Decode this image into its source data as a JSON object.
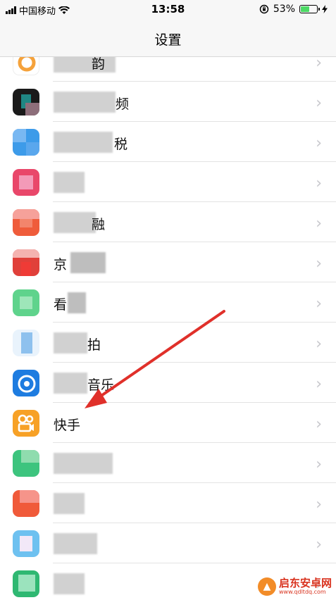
{
  "status_bar": {
    "carrier": "中国移动",
    "time": "13:58",
    "battery_percent": "53%",
    "battery_level": 0.53
  },
  "nav": {
    "title": "设置"
  },
  "rows": [
    {
      "label": "",
      "fragment": "韵",
      "icon_color": "#f5a23b"
    },
    {
      "label": "",
      "fragment": "频",
      "icon_color": "#1a1a1a"
    },
    {
      "label": "",
      "fragment": "税",
      "icon_color": "#3d9be9"
    },
    {
      "label": "",
      "fragment": "",
      "icon_color": "#e9476a"
    },
    {
      "label": "",
      "fragment": "融",
      "icon_color": "#ef5c3b"
    },
    {
      "label": "",
      "fragment": "京",
      "icon_color": "#e0403a"
    },
    {
      "label": "",
      "fragment": "看",
      "icon_color": "#5fd38c"
    },
    {
      "label": "",
      "fragment": "拍",
      "icon_color": "#8ec1ee"
    },
    {
      "label": "",
      "fragment": "音乐",
      "icon_color": "#1e7ce0"
    },
    {
      "label": "快手",
      "fragment": "",
      "icon_color": "#f7a126"
    },
    {
      "label": "",
      "fragment": "",
      "icon_color": "#3dc47e"
    },
    {
      "label": "",
      "fragment": "",
      "icon_color": "#f05a3a"
    },
    {
      "label": "",
      "fragment": "",
      "icon_color": "#6ec1f0"
    },
    {
      "label": "",
      "fragment": "",
      "icon_color": "#2fb872"
    }
  ],
  "watermark": {
    "name": "启东安卓网",
    "url": "www.qdltdq.com"
  }
}
